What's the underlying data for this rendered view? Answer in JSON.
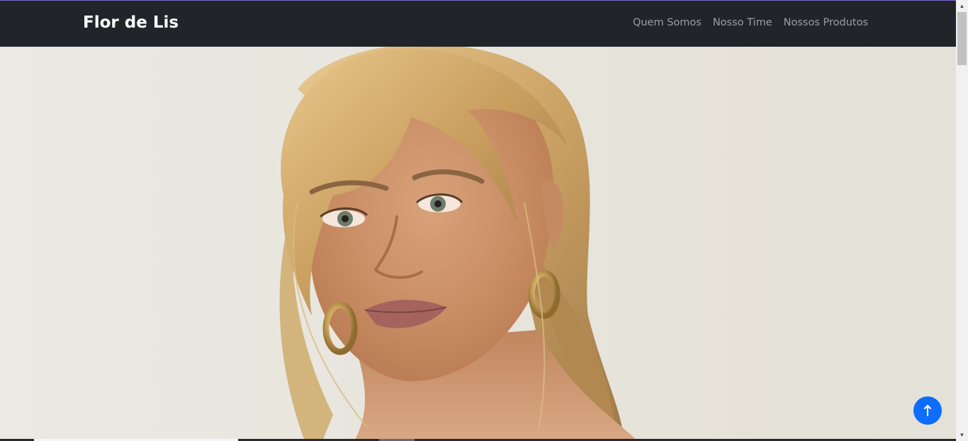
{
  "navbar": {
    "brand": "Flor de Lis",
    "links": [
      "Quem Somos",
      "Nosso Time",
      "Nossos Produtos"
    ]
  },
  "hero": {
    "image_alt": "woman-portrait-photo"
  },
  "colors": {
    "navbar_bg": "#212529",
    "brand_text": "#ffffff",
    "nav_link_text": "rgba(255,255,255,0.55)",
    "back_to_top_bg": "#0d6efd"
  },
  "icons": {
    "back_to_top": "arrow-up-icon"
  }
}
